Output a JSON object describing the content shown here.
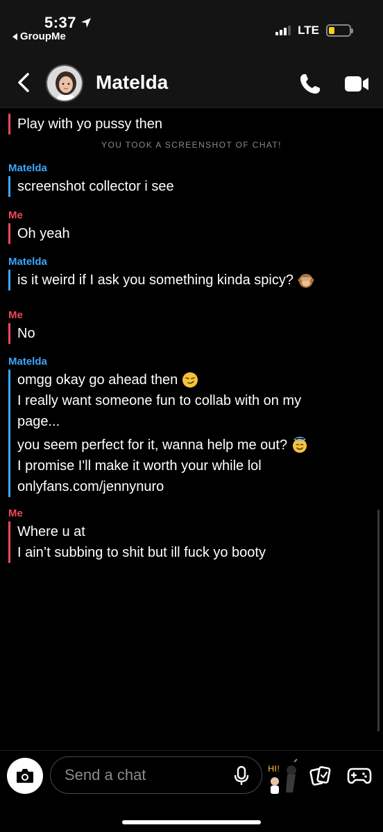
{
  "status_bar": {
    "time": "5:37",
    "back_app": "GroupMe",
    "network": "LTE",
    "battery_level": 0.3
  },
  "header": {
    "contact_name": "Matelda"
  },
  "messages": [
    {
      "sender": "",
      "who": "me",
      "lines": [
        "Play with yo pussy then"
      ]
    },
    {
      "system": "YOU TOOK A SCREENSHOT OF CHAT!"
    },
    {
      "sender": "Matelda",
      "who": "them",
      "lines": [
        "screenshot collector i see"
      ]
    },
    {
      "sender": "Me",
      "who": "me",
      "lines": [
        "Oh yeah"
      ]
    },
    {
      "sender": "Matelda",
      "who": "them",
      "lines": [
        "is it weird if I ask you something kinda spicy?"
      ]
    },
    {
      "sender": "Me",
      "who": "me",
      "lines": [
        "No"
      ]
    },
    {
      "sender": "Matelda",
      "who": "them",
      "lines": [
        "omgg okay go ahead then",
        "I really want someone fun to collab with on my",
        "page...",
        "you seem perfect for it, wanna help me out?",
        "I promise I'll make it worth your while lol",
        "onlyfans.com/jennynuro"
      ]
    },
    {
      "sender": "Me",
      "who": "me",
      "lines": [
        "Where u at",
        "I ain’t subbing to shit but ill fuck yo booty"
      ]
    }
  ],
  "composer": {
    "placeholder": "Send a chat"
  },
  "bitmoji_text": "HI!",
  "icons": {
    "location": "location-arrow-icon",
    "back": "chevron-left-icon",
    "call": "phone-icon",
    "video": "video-camera-icon",
    "camera": "camera-icon",
    "mic": "microphone-icon",
    "cards": "cards-icon",
    "games": "gamepad-icon"
  },
  "emojis": {
    "spicy": "see-no-evil-monkey",
    "okay": "smirking-face",
    "help": "smiling-face-with-halo"
  }
}
